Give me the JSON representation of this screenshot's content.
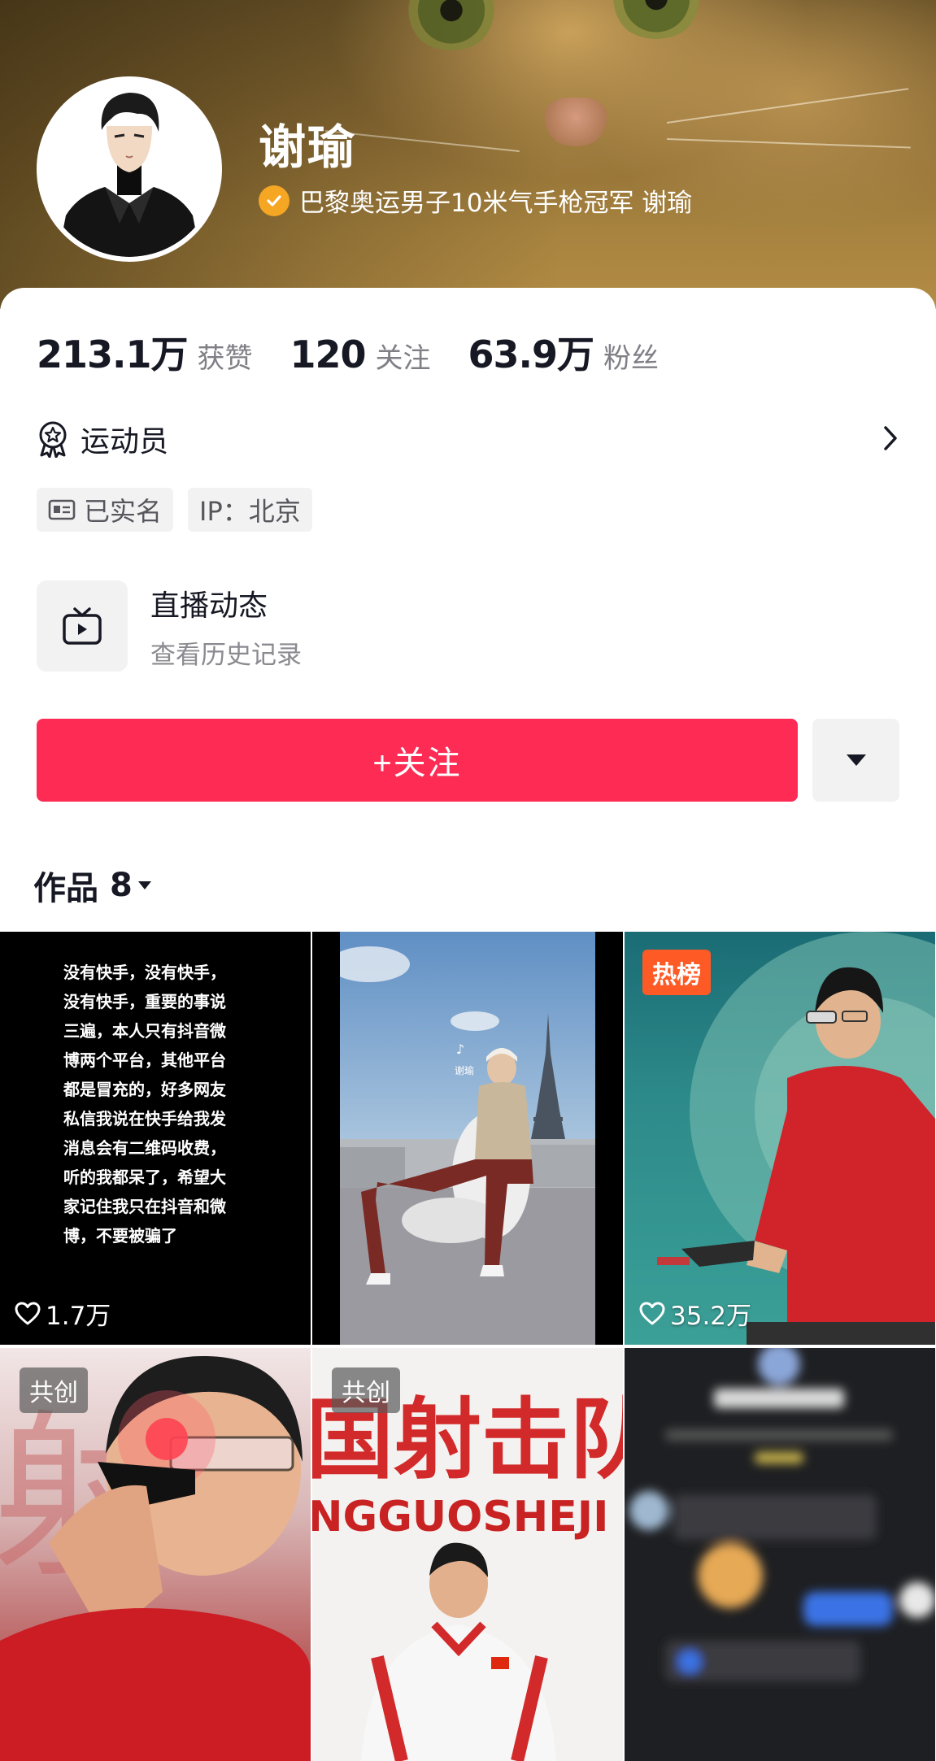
{
  "profile": {
    "name": "谢瑜",
    "verify_text": "巴黎奥运男子10米气手枪冠军 谢瑜"
  },
  "stats": [
    {
      "value": "213.1万",
      "label": "获赞"
    },
    {
      "value": "120",
      "label": "关注"
    },
    {
      "value": "63.9万",
      "label": "粉丝"
    }
  ],
  "role": {
    "label": "运动员"
  },
  "tags": [
    {
      "label": "已实名",
      "icon": "id-card-icon"
    },
    {
      "label": "IP：北京"
    }
  ],
  "live": {
    "title": "直播动态",
    "subtitle": "查看历史记录"
  },
  "actions": {
    "follow_label": "+关注"
  },
  "works": {
    "label": "作品",
    "count": "8"
  },
  "grid": {
    "items": [
      {
        "text": "没有快手，没有快手，\n没有快手，重要的事说\n三遍，本人只有抖音微\n博两个平台，其他平台\n都是冒充的，好多网友\n私信我说在快手给我发\n消息会有二维码收费，\n听的我都呆了，希望大\n家记住我只在抖音和微\n博，不要被骗了",
        "likes": "1.7万"
      },
      {
        "watermark": "谢瑜"
      },
      {
        "badge": "热榜",
        "likes": "35.2万"
      },
      {
        "badge": "共创",
        "bg_text": "射"
      },
      {
        "badge": "共创",
        "banner_text": "国射击队",
        "banner_sub": "NGGUOSHEJI"
      },
      {}
    ]
  },
  "colors": {
    "accent": "#fe2c55",
    "verify": "#f5a623",
    "hot": "#fe5a26"
  }
}
